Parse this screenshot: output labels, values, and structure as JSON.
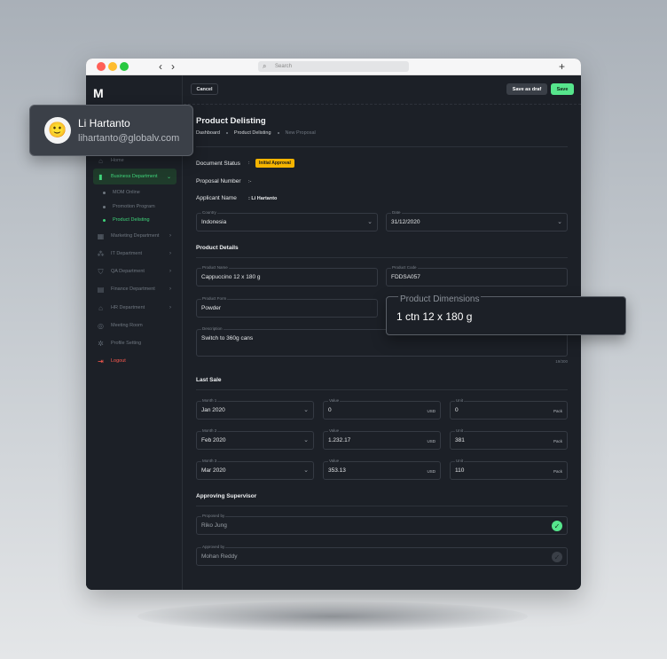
{
  "browser": {
    "search_placeholder": "Search"
  },
  "logo": "M",
  "user": {
    "name": "Li Hartanto",
    "email": "lihartanto@globalv.com"
  },
  "sidebar": {
    "items": [
      {
        "label": "Home"
      },
      {
        "label": "Business Department",
        "active": true
      },
      {
        "label": "Marketing Department"
      },
      {
        "label": "IT Department"
      },
      {
        "label": "QA Department"
      },
      {
        "label": "Finance Department"
      },
      {
        "label": "HR Department"
      },
      {
        "label": "Meeting Room"
      },
      {
        "label": "Profile Setting"
      },
      {
        "label": "Logout"
      }
    ],
    "subitems": [
      {
        "label": "MOM Online"
      },
      {
        "label": "Promotion Program"
      },
      {
        "label": "Product Delisting",
        "current": true
      }
    ]
  },
  "toolbar": {
    "cancel_label": "Cancel",
    "draft_label": "Save as draf",
    "save_label": "Save"
  },
  "page": {
    "title": "Product Delisting",
    "breadcrumb": [
      "Dashboard",
      "Product Delisting",
      "New Proposal"
    ]
  },
  "info": {
    "status_label": "Document Status",
    "status_value": "Initial Approval",
    "proposal_label": "Proposal Number",
    "proposal_value": ":-",
    "applicant_label": "Applicant Name",
    "applicant_value": ": Li Hartanto"
  },
  "country": {
    "label": "Country",
    "value": "Indonesia"
  },
  "date": {
    "label": "Date",
    "value": "31/12/2020"
  },
  "product": {
    "section_title": "Product Details",
    "name_label": "Product Name",
    "name_value": "Cappuccino 12 x 180 g",
    "code_label": "Product Code",
    "code_value": "FDDSA057",
    "form_label": "Product Form",
    "form_value": "Powder",
    "dimensions_label": "Product Dimensions",
    "dimensions_value": "1 ctn 12 x 180 g",
    "description_label": "Description",
    "description_value": "Switch to 360g cans",
    "counter": "19/300"
  },
  "last_sale": {
    "section_title": "Last Sale",
    "rows": [
      {
        "month_label": "Month 1",
        "month": "Jan 2020",
        "value_label": "Value",
        "value": "0",
        "currency": "USD",
        "unit_label": "Unit",
        "unit": "0",
        "unit_suffix": "Pack"
      },
      {
        "month_label": "Month 2",
        "month": "Feb 2020",
        "value_label": "Value",
        "value": "1.232.17",
        "currency": "USD",
        "unit_label": "Unit",
        "unit": "381",
        "unit_suffix": "Pack"
      },
      {
        "month_label": "Month 3",
        "month": "Mar 2020",
        "value_label": "Value",
        "value": "353.13",
        "currency": "USD",
        "unit_label": "Unit",
        "unit": "110",
        "unit_suffix": "Pack"
      }
    ]
  },
  "approval": {
    "section_title": "Approving Supervisor",
    "proposed_label": "Proposed by",
    "proposed_value": "Riko Jung",
    "approved_label": "Approved by",
    "approved_value": "Mohan Reddy"
  }
}
